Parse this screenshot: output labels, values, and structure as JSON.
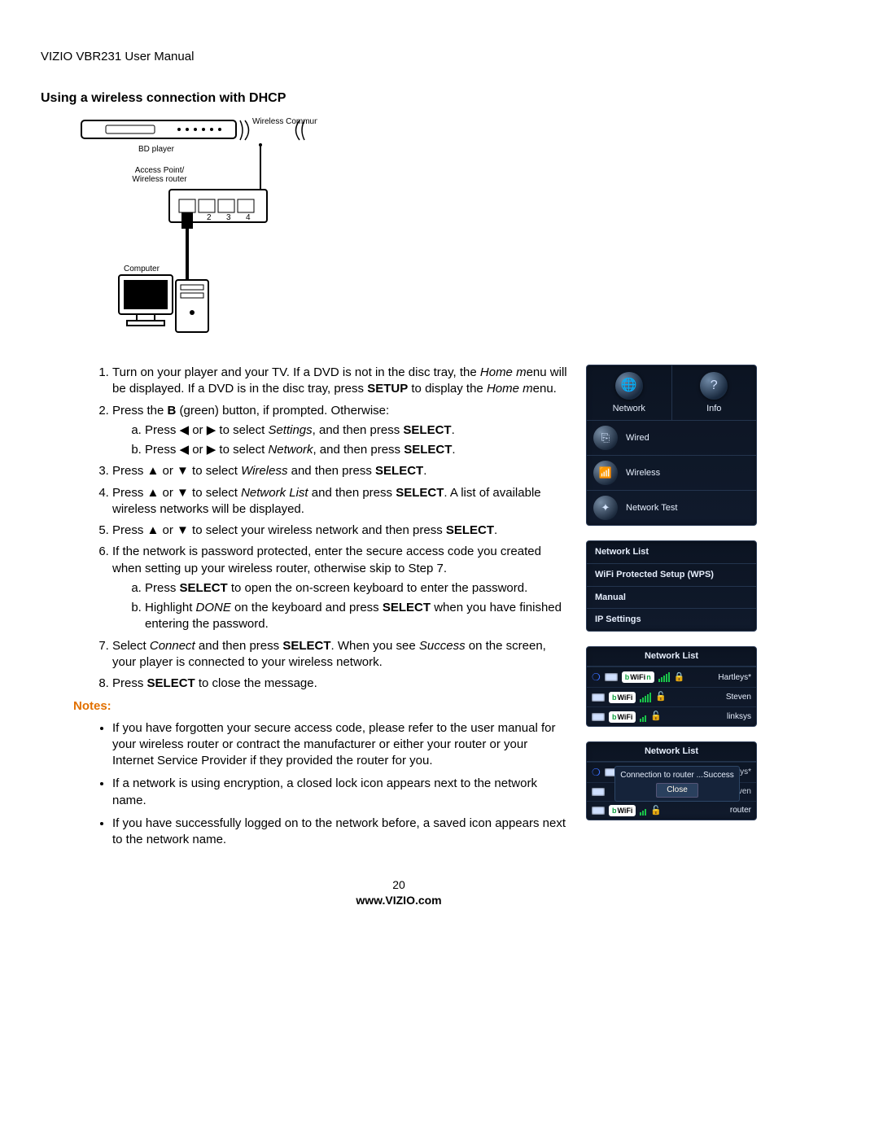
{
  "header": "VIZIO VBR231 User Manual",
  "section_title": "Using a wireless connection with DHCP",
  "diagram": {
    "wireless_comm": "Wireless Communication",
    "bd_player": "BD player",
    "access_point": "Access Point/ Wireless router",
    "computer": "Computer"
  },
  "steps": {
    "s1a": "Turn on your player and your TV. If a DVD is not in the disc tray, the ",
    "s1b": "Home m",
    "s1c": "enu will be displayed. If a DVD is in the disc tray, press ",
    "s1d": "SETUP",
    "s1e": " to display the ",
    "s1f": "Home m",
    "s1g": "enu.",
    "s2a": "Press the ",
    "s2b": "B",
    "s2c": " (green) button, if prompted. Otherwise:",
    "s2sa1": "Press ◀ or ▶ to select ",
    "s2sa2": "Settings",
    "s2sa3": ", and then press ",
    "s2sa4": "SELECT",
    "s2sa5": ".",
    "s2sb1": "Press ◀ or ▶ to select ",
    "s2sb2": "Network",
    "s2sb3": ", and then press ",
    "s2sb4": "SELECT",
    "s2sb5": ".",
    "s3a": "Press ▲ or ▼ to select ",
    "s3b": "Wireless",
    "s3c": " and then press ",
    "s3d": "SELECT",
    "s3e": ".",
    "s4a": "Press ▲ or ▼ to select ",
    "s4b": "Network List",
    "s4c": " and then press ",
    "s4d": "SELECT",
    "s4e": ". A list of available wireless networks will be displayed.",
    "s5a": "Press ▲ or ▼ to select your wireless network and then press ",
    "s5b": "SELECT",
    "s5c": ".",
    "s6": "If the network is password protected, enter the secure access code you created when setting up your wireless router, otherwise skip to Step 7.",
    "s6sa1": "Press ",
    "s6sa2": "SELECT",
    "s6sa3": " to open the on-screen keyboard to enter the password.",
    "s6sb1": "Highlight ",
    "s6sb2": "DONE",
    "s6sb3": " on the keyboard and press ",
    "s6sb4": "SELECT",
    "s6sb5": " when you have finished entering the password.",
    "s7a": "Select ",
    "s7b": "Connect",
    "s7c": " and then press ",
    "s7d": "SELECT",
    "s7e": ". When you see ",
    "s7f": "Success",
    "s7g": " on the screen, your player is connected to your wireless network.",
    "s8a": "Press ",
    "s8b": "SELECT",
    "s8c": " to close the message."
  },
  "notes_heading": "Notes:",
  "notes": [
    "If you have forgotten your secure access code, please refer to the user manual for your wireless router or contract the manufacturer or either your router or your Internet Service Provider if they provided the router for you.",
    "If a network is using encryption, a closed lock icon appears next to the network name.",
    "If you have successfully logged on to the network before, a saved icon appears next to the network name."
  ],
  "panel1": {
    "tab1": "Network",
    "tab2": "Info",
    "row1": "Wired",
    "row2": "Wireless",
    "row3": "Network Test"
  },
  "panel2": {
    "r1": "Network List",
    "r2": "WiFi Protected Setup (WPS)",
    "r3": "Manual",
    "r4": "IP Settings"
  },
  "panel3": {
    "title": "Network List",
    "nets": [
      {
        "badge_b": "b",
        "badge_wifi": "WiFi",
        "badge_n": "n",
        "lock": "🔒",
        "name": "Hartleys*"
      },
      {
        "badge_b": "b",
        "badge_wifi": "WiFi",
        "badge_n": "",
        "lock": "🔓",
        "name": "Steven"
      },
      {
        "badge_b": "b",
        "badge_wifi": "WiFi",
        "badge_n": "",
        "lock": "🔓",
        "name": "linksys"
      }
    ]
  },
  "panel4": {
    "title": "Network List",
    "dialog": "Connection to router ...Success",
    "close": "Close",
    "right1": "rtleys*",
    "right2": "even",
    "right3": "router",
    "badge_b": "b",
    "badge_wifi": "WiFi"
  },
  "footer": {
    "page": "20",
    "url": "www.VIZIO.com"
  }
}
